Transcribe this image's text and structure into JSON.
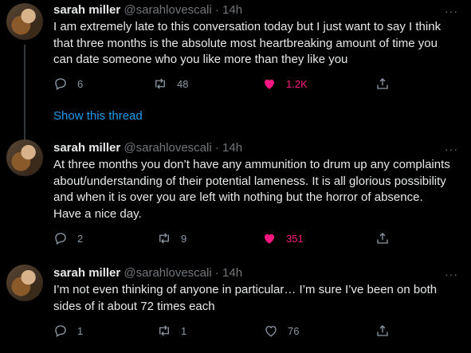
{
  "tweets": [
    {
      "name": "sarah miller",
      "handle": "@sarahlovescali",
      "dot": "·",
      "time": "14h",
      "more": "···",
      "text": "I am extremely late to this conversation today but I just want to say I think that three months is the absolute most heartbreaking amount of time you can date someone who you like more than they like you",
      "replies": "6",
      "retweets": "48",
      "likes": "1.2K",
      "liked": true
    },
    {
      "name": "sarah miller",
      "handle": "@sarahlovescali",
      "dot": "·",
      "time": "14h",
      "more": "···",
      "text": "At three months you don’t have any ammunition to drum up any complaints about/understanding of their potential lameness. It is all glorious possibility and when it is over you are left with nothing but the horror of absence. Have a nice day.",
      "replies": "2",
      "retweets": "9",
      "likes": "351",
      "liked": true
    },
    {
      "name": "sarah miller",
      "handle": "@sarahlovescali",
      "dot": "·",
      "time": "14h",
      "more": "···",
      "text": "I’m not even thinking of anyone in particular… I’m sure I’ve been on both sides of it about 72 times each",
      "replies": "1",
      "retweets": "1",
      "likes": "76",
      "liked": false
    }
  ],
  "show_thread": "Show this thread",
  "icons": {
    "reply": "reply-icon",
    "retweet": "retweet-icon",
    "like": "heart-icon",
    "share": "share-icon"
  },
  "colors": {
    "background": "#000000",
    "link": "#1d9bf0",
    "like": "#f91880",
    "muted": "#71767b"
  }
}
